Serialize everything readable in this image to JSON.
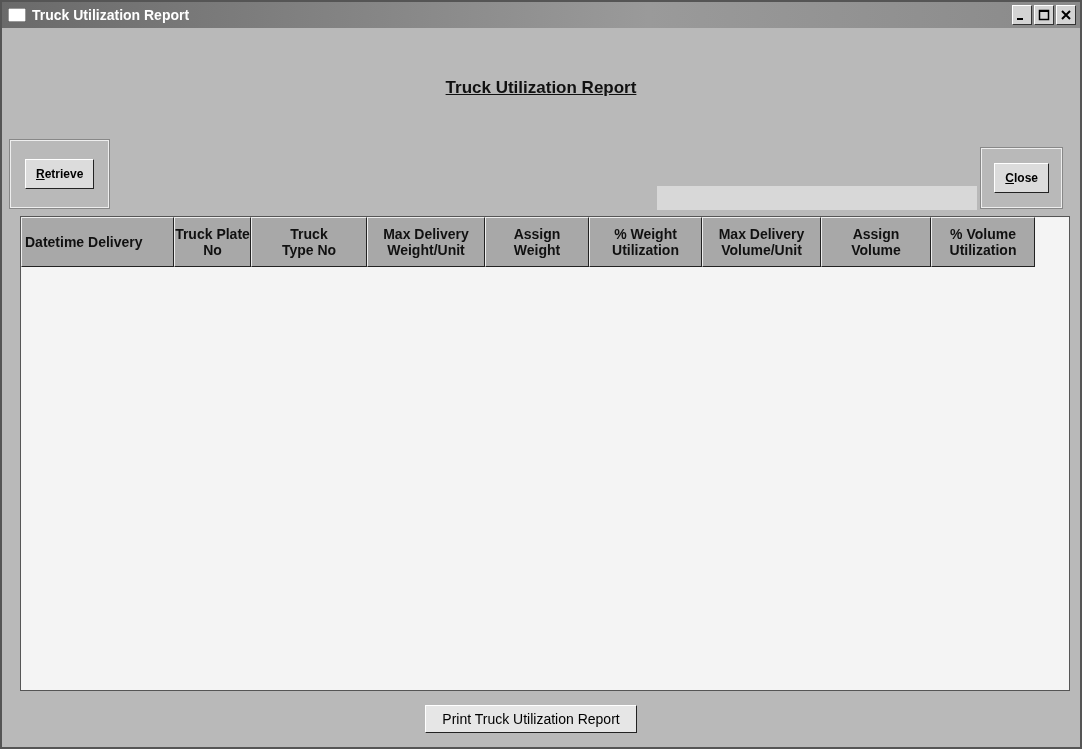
{
  "window": {
    "title": "Truck Utilization Report"
  },
  "heading": "Truck Utilization Report",
  "retrieve_button": {
    "mnemonic": "R",
    "rest": "etrieve"
  },
  "close_button": {
    "mnemonic": "C",
    "rest": "lose"
  },
  "table": {
    "columns": [
      {
        "lines": [
          "Datetime Delivery"
        ]
      },
      {
        "lines": [
          "Truck Plate",
          "No"
        ]
      },
      {
        "lines": [
          "Truck",
          "Type No"
        ]
      },
      {
        "lines": [
          "Max Delivery",
          "Weight/Unit"
        ]
      },
      {
        "lines": [
          "Assign",
          "Weight"
        ]
      },
      {
        "lines": [
          "% Weight",
          "Utilization"
        ]
      },
      {
        "lines": [
          "Max Delivery",
          "Volume/Unit"
        ]
      },
      {
        "lines": [
          "Assign",
          "Volume"
        ]
      },
      {
        "lines": [
          "% Volume",
          "Utilization"
        ]
      }
    ]
  },
  "print_button": "Print Truck Utilization Report"
}
